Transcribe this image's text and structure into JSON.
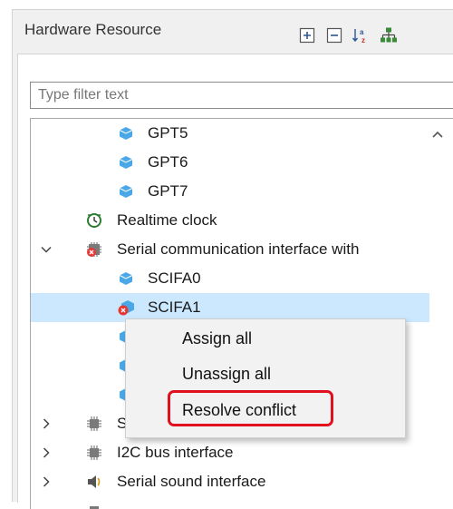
{
  "panel": {
    "title": "Hardware Resource",
    "toolbar_icons": [
      "expand-all-icon",
      "collapse-all-icon",
      "sort-alpha-icon",
      "hierarchy-icon"
    ]
  },
  "filter": {
    "placeholder": "Type filter text",
    "value": ""
  },
  "tree": {
    "items": [
      {
        "label": "GPT5",
        "icon": "module-cube-icon"
      },
      {
        "label": "GPT6",
        "icon": "module-cube-icon"
      },
      {
        "label": "GPT7",
        "icon": "module-cube-icon"
      },
      {
        "label": "Realtime clock",
        "icon": "clock-icon"
      },
      {
        "label": "Serial communication interface with",
        "icon": "chip-error-icon",
        "expanded": true
      },
      {
        "label": "SCIFA0",
        "icon": "module-cube-icon"
      },
      {
        "label": "SCIFA1",
        "icon": "module-cube-error-icon",
        "selected": true
      },
      {
        "label": "",
        "icon": "module-cube-icon"
      },
      {
        "label": "",
        "icon": "module-cube-icon"
      },
      {
        "label": "",
        "icon": "module-cube-icon"
      },
      {
        "label": "Ser",
        "icon": "chip-icon",
        "collapsed": true
      },
      {
        "label": "I2C bus interface",
        "icon": "chip-icon",
        "collapsed": true
      },
      {
        "label": "Serial sound interface",
        "icon": "speaker-icon",
        "collapsed": true
      }
    ]
  },
  "context_menu": {
    "items": [
      "Assign all",
      "Unassign all",
      "Resolve conflict"
    ],
    "highlighted": "Resolve conflict"
  },
  "colors": {
    "selection": "#cce8ff",
    "highlight_border": "#e0101c"
  }
}
